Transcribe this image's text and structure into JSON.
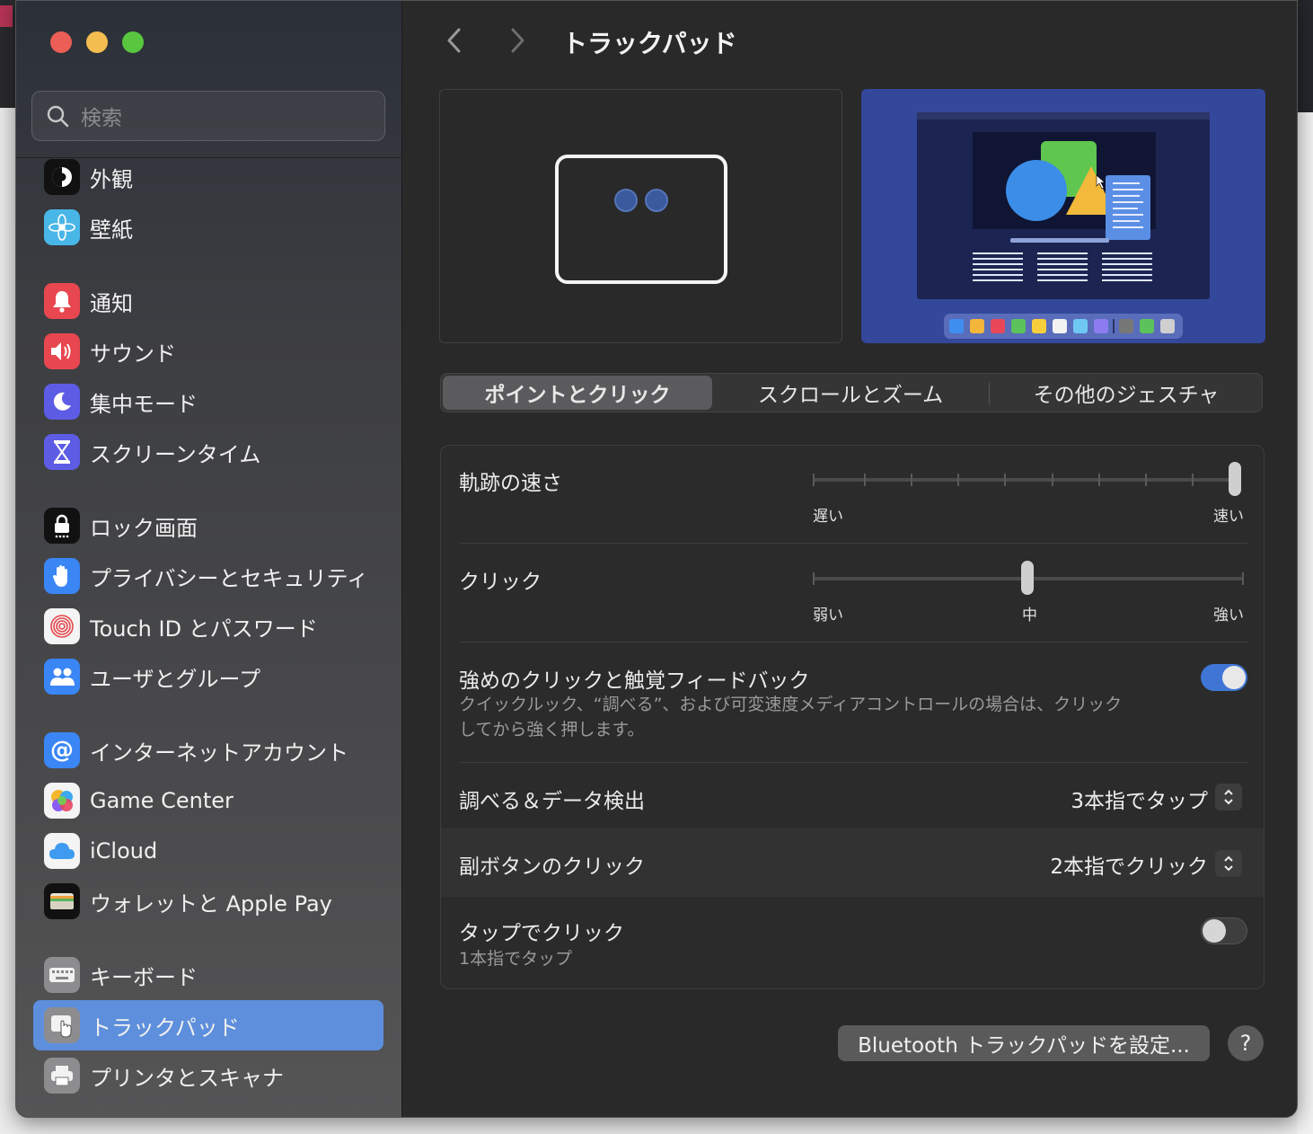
{
  "window": {
    "title": "トラックパッド"
  },
  "search": {
    "placeholder": "検索"
  },
  "sidebar": {
    "items": [
      {
        "label": "外観",
        "icon": "appearance-icon",
        "color": "#1b1b1b"
      },
      {
        "label": "壁紙",
        "icon": "flower-icon",
        "color": "#48b7e6"
      },
      {
        "label": "通知",
        "icon": "bell-icon",
        "color": "#e8444d"
      },
      {
        "label": "サウンド",
        "icon": "speaker-icon",
        "color": "#e8444d"
      },
      {
        "label": "集中モード",
        "icon": "moon-icon",
        "color": "#5e5ce6"
      },
      {
        "label": "スクリーンタイム",
        "icon": "hourglass-icon",
        "color": "#5e5ce6"
      },
      {
        "label": "ロック画面",
        "icon": "lock-icon",
        "color": "#1b1b1b"
      },
      {
        "label": "プライバシーとセキュリティ",
        "icon": "hand-icon",
        "color": "#3b82f6"
      },
      {
        "label": "Touch ID とパスワード",
        "icon": "fingerprint-icon",
        "color": "#f2f2f2"
      },
      {
        "label": "ユーザとグループ",
        "icon": "users-icon",
        "color": "#3b82f6"
      },
      {
        "label": "インターネットアカウント",
        "icon": "at-icon",
        "color": "#3b82f6"
      },
      {
        "label": "Game Center",
        "icon": "game-center-icon",
        "color": "#f2f2f2"
      },
      {
        "label": "iCloud",
        "icon": "cloud-icon",
        "color": "#f2f2f2"
      },
      {
        "label": "ウォレットと Apple Pay",
        "icon": "wallet-icon",
        "color": "#1b1b1b"
      },
      {
        "label": "キーボード",
        "icon": "keyboard-icon",
        "color": "#8a8a8a"
      },
      {
        "label": "トラックパッド",
        "icon": "trackpad-icon",
        "color": "#8a8a8a",
        "selected": true
      },
      {
        "label": "プリンタとスキャナ",
        "icon": "printer-icon",
        "color": "#8a8a8a"
      }
    ]
  },
  "tabs": [
    {
      "label": "ポイントとクリック",
      "active": true
    },
    {
      "label": "スクロールとズーム",
      "active": false
    },
    {
      "label": "その他のジェスチャ",
      "active": false
    }
  ],
  "settings": {
    "tracking_speed": {
      "label": "軌跡の速さ",
      "min_label": "遅い",
      "max_label": "速い",
      "value_fraction": 1.0
    },
    "click": {
      "label": "クリック",
      "min_label": "弱い",
      "mid_label": "中",
      "max_label": "強い",
      "value_fraction": 0.5
    },
    "force_click": {
      "label": "強めのクリックと触覚フィードバック",
      "description_line1": "クイックルック、“調べる”、および可変速度メディアコントロールの場合は、クリック",
      "description_line2": "してから強く押します。",
      "enabled": true
    },
    "lookup": {
      "label": "調べる＆データ検出",
      "value": "3本指でタップ"
    },
    "secondary_click": {
      "label": "副ボタンのクリック",
      "value": "2本指でクリック"
    },
    "tap_to_click": {
      "label": "タップでクリック",
      "description": "1本指でタップ",
      "enabled": false
    }
  },
  "buttons": {
    "bluetooth": "Bluetooth トラックパッドを設定...",
    "help": "?"
  },
  "colors": {
    "accent": "#5e8fdc",
    "toggle_on": "#3f76d6"
  }
}
